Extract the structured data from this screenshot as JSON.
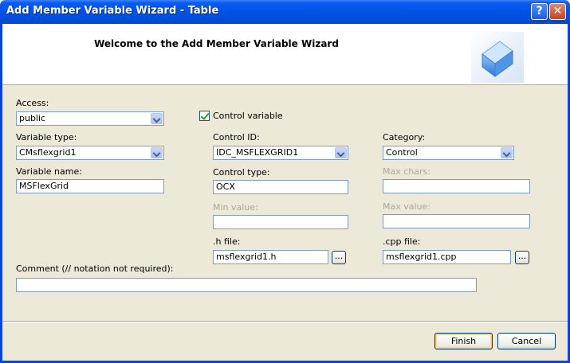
{
  "window": {
    "title": "Add Member Variable Wizard - Table",
    "help_label": "?",
    "close_label": "✕"
  },
  "header": {
    "title": "Welcome to the Add Member Variable Wizard",
    "logo_icon": "cube-icon"
  },
  "form": {
    "access": {
      "label": "Access:",
      "value": "public"
    },
    "control_variable": {
      "label": "Control variable",
      "checked": true
    },
    "variable_type": {
      "label": "Variable type:",
      "value": "CMsflexgrid1"
    },
    "control_id": {
      "label": "Control ID:",
      "value": "IDC_MSFLEXGRID1"
    },
    "category": {
      "label": "Category:",
      "value": "Control"
    },
    "variable_name": {
      "label": "Variable name:",
      "value": "MSFlexGrid"
    },
    "control_type": {
      "label": "Control type:",
      "value": "OCX"
    },
    "max_chars": {
      "label": "Max chars:",
      "value": ""
    },
    "min_value": {
      "label": "Min value:",
      "value": ""
    },
    "max_value": {
      "label": "Max value:",
      "value": ""
    },
    "h_file": {
      "label": ".h file:",
      "value": "msflexgrid1.h",
      "browse_label": "..."
    },
    "cpp_file": {
      "label": ".cpp file:",
      "value": "msflexgrid1.cpp",
      "browse_label": "..."
    },
    "comment": {
      "label": "Comment (// notation not required):",
      "value": ""
    }
  },
  "buttons": {
    "finish": "Finish",
    "cancel": "Cancel"
  },
  "colors": {
    "titlebar": "#0053e6",
    "dialog_bg": "#ece9d8",
    "field_border": "#7f9db9",
    "disabled_text": "#aca899"
  }
}
